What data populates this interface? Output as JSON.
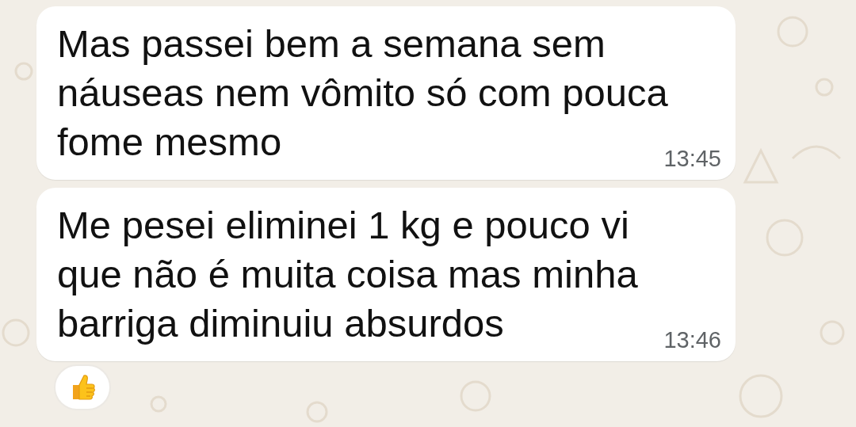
{
  "messages": [
    {
      "text": "Mas passei bem a semana sem\nnáuseas nem vômito só com pouca\nfome mesmo",
      "time": "13:45",
      "reaction": false
    },
    {
      "text": "Me pesei eliminei 1 kg e pouco vi\nque não é muita coisa mas minha\nbarriga diminuiu absurdos",
      "time": "13:46",
      "reaction": true
    }
  ]
}
